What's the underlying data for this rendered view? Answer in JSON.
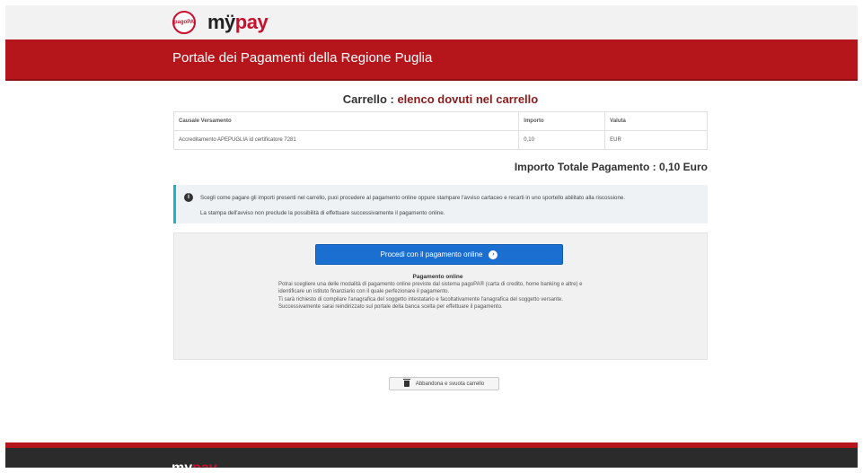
{
  "header": {
    "badge_text": "pagoPA",
    "brand_my": "mÿ",
    "brand_pay": "pay",
    "portal_title": "Portale dei Pagamenti della Regione Puglia"
  },
  "cart": {
    "title_prefix": "Carrello : ",
    "title_emphasis": "elenco dovuti nel carrello",
    "columns": [
      "Causale Versamento",
      "Importo",
      "Valuta"
    ],
    "rows": [
      [
        "Accreditamento APEPUGLIA id certificatore 7281",
        "0,10",
        "EUR"
      ]
    ],
    "total_text": "Importo Totale Pagamento : 0,10 Euro"
  },
  "info": {
    "line1": "Scegli come pagare gli importi presenti nel carrello, puoi procedere al pagamento online oppure stampare l'avviso cartaceo e recarti in uno sportello abilitato alla riscossione.",
    "line2": "La stampa dell'avviso non preclude la possibilità di effettuare successivamente il pagamento online."
  },
  "payment": {
    "button_label": "Procedi con il pagamento online",
    "heading": "Pagamento online",
    "paragraph1": "Potrai scegliere una delle modalità di pagamento online previste dal sistema pagoPA® (carta di credito, home banking e altre) e identificare un istituto finanziario con il quale perfezionare il pagamento.",
    "paragraph2": "Ti sarà richiesto di compilare l'anagrafica del soggetto intestatario e facoltativamente l'anagrafica del soggetto versante. Successivamente sarai reindirizzato sul portale della banca scelta per effettuare il pagamento."
  },
  "actions": {
    "abandon_label": "Abbandona e svuota carrello"
  },
  "footer": {
    "brand_my": "my",
    "brand_pay": "pay"
  },
  "colors": {
    "brand_red": "#b5161b",
    "button_blue": "#1a6fd1",
    "info_accent": "#1bb3c8"
  }
}
